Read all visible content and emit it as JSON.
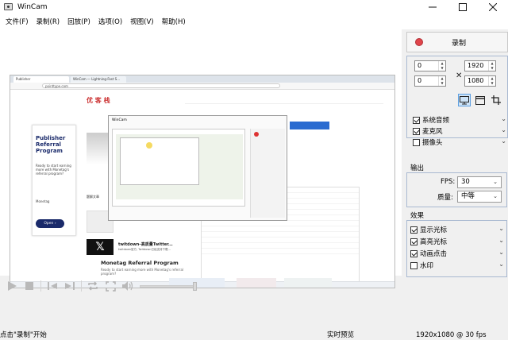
{
  "window": {
    "title": "WinCam",
    "minimize": "—",
    "maximize": "☐",
    "close": "✕"
  },
  "menu": [
    {
      "label": "文件(F)"
    },
    {
      "label": "录制(R)"
    },
    {
      "label": "回放(P)"
    },
    {
      "label": "选项(O)"
    },
    {
      "label": "视图(V)"
    },
    {
      "label": "帮助(H)"
    }
  ],
  "preview": {
    "browser_tab": "Publisher",
    "browser_tab2": "WinCam — Lightning-Fast S...",
    "url": "pointtype.com",
    "site_logo": "优 客 栈",
    "ad_title": "Publisher Referral Program",
    "ad_desc": "Ready to start earning more with Monetag's referral program?",
    "ad_brand": "Monetag",
    "ad_button": "Open  ›",
    "bottom_title": "Monetag Referral Program",
    "bottom_sub": "Ready to start earning more with Monetag's referral program?",
    "tw_title": "twitdown–高质量Twitter...",
    "tw_sub": "twitdown官方, Twitdown已经支持下载...",
    "section_tag": "题解文章",
    "nested_title": "WinCam"
  },
  "controls": {
    "icons": [
      "play-icon",
      "stop-icon",
      "skip-start-icon",
      "skip-end-icon",
      "loop-icon",
      "fullscreen-icon",
      "volume-icon"
    ],
    "volume_level": 0.95
  },
  "status": {
    "hint": "点击\"录制\"开始",
    "mode": "实时预览",
    "resolution": "1920x1080 @ 30 fps"
  },
  "panel": {
    "record_label": "录制",
    "region": {
      "x": "0",
      "y": "0",
      "width": "1920",
      "height": "1080",
      "cross": "✕",
      "selected_mode": "fullscreen"
    },
    "sources": [
      {
        "label": "系统音频",
        "checked": true
      },
      {
        "label": "麦克风",
        "checked": true
      },
      {
        "label": "摄像头",
        "checked": false
      }
    ],
    "output_label": "输出",
    "fps_label": "FPS:",
    "fps_value": "30",
    "quality_label": "质量:",
    "quality_value": "中等",
    "effects_label": "效果",
    "effects": [
      {
        "label": "显示光标",
        "checked": true
      },
      {
        "label": "高亮光标",
        "checked": true
      },
      {
        "label": "动画点击",
        "checked": true
      },
      {
        "label": "水印",
        "checked": false
      }
    ]
  }
}
